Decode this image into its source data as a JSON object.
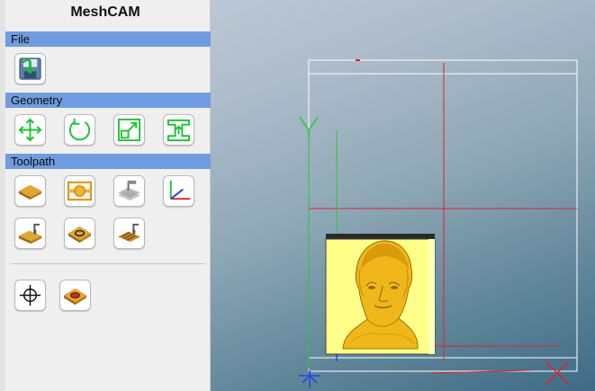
{
  "app": {
    "title": "MeshCAM"
  },
  "sections": {
    "file": "File",
    "geometry": "Geometry",
    "toolpath": "Toolpath"
  },
  "icons": {
    "file": [
      "save-icon"
    ],
    "geometry": [
      "move-icon",
      "rotate-icon",
      "scale-icon",
      "raise-part-icon"
    ],
    "toolpath": [
      "stock-icon",
      "region-select-icon",
      "depth-icon",
      "axes-icon",
      "roughing-icon",
      "contour-icon",
      "finishing-icon"
    ],
    "extra": [
      "crosshair-origin-icon",
      "holes-icon"
    ]
  },
  "colors": {
    "section_bar": "#6f9ce0",
    "panel": "#efefef",
    "part_color": "#f0b71a",
    "stock_color": "#ffff88",
    "x_axis": "#e0202a",
    "y_axis": "#22cc33",
    "z_axis": "#2244ee"
  }
}
